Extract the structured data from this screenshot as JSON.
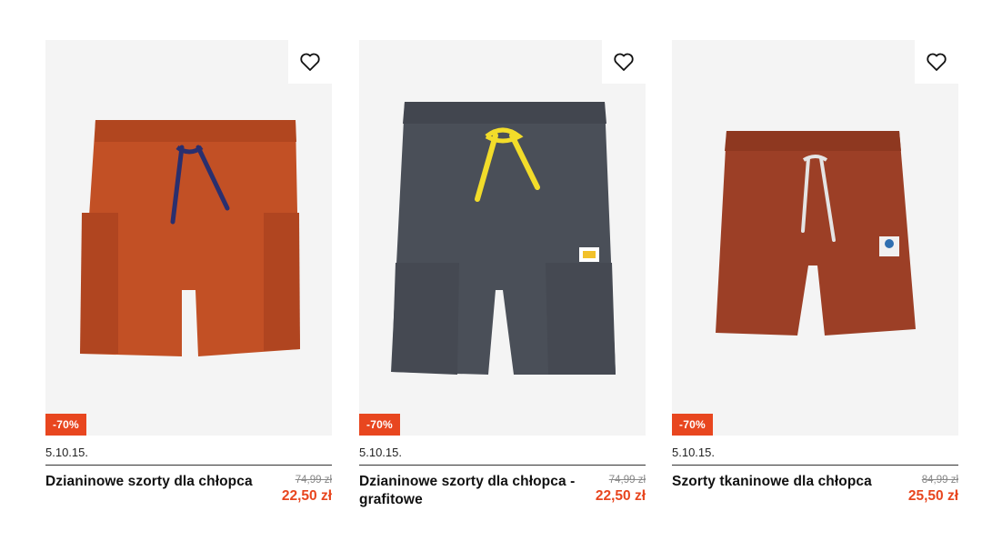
{
  "products": [
    {
      "badge": "-70%",
      "brand": "5.10.15.",
      "title": "Dzianinowe szorty dla chłopca",
      "old_price": "74,99 zł",
      "new_price": "22,50 zł",
      "favorite_icon": "heart-outline-icon",
      "colors": {
        "main": "#c25025",
        "drawstring": "#2a2f6e"
      }
    },
    {
      "badge": "-70%",
      "brand": "5.10.15.",
      "title": "Dzianinowe szorty dla chłopca -grafitowe",
      "old_price": "74,99 zł",
      "new_price": "22,50 zł",
      "favorite_icon": "heart-outline-icon",
      "colors": {
        "main": "#4a4f58",
        "drawstring": "#f2dc2a"
      }
    },
    {
      "badge": "-70%",
      "brand": "5.10.15.",
      "title": "Szorty tkaninowe dla chłopca",
      "old_price": "84,99 zł",
      "new_price": "25,50 zł",
      "favorite_icon": "heart-outline-icon",
      "colors": {
        "main": "#9c3f26",
        "drawstring": "#e4e4e4"
      }
    }
  ],
  "colors": {
    "accent": "#e8461f",
    "image_bg": "#f4f4f4"
  }
}
